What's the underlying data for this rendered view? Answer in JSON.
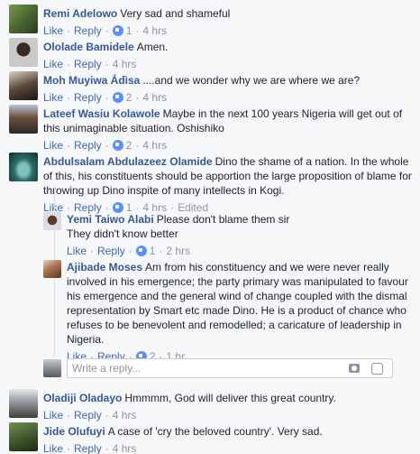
{
  "comments": [
    {
      "name": "Remi Adelowo",
      "text": "Very sad and shameful",
      "like": "Like",
      "reply": "Reply",
      "reactions": "1",
      "time": "4 hrs"
    },
    {
      "name": "Ololade Bamidele",
      "text": "Amen.",
      "like": "Like",
      "reply": "Reply",
      "time": "4 hrs"
    },
    {
      "name": "Moh Muyiwa Ádìsa",
      "text": "....and we wonder why we are where we are?",
      "like": "Like",
      "reply": "Reply",
      "reactions": "2",
      "time": "4 hrs"
    },
    {
      "name": "Lateef Wasiu Kolawole",
      "text": "Maybe in the next 100 years Nigeria will get out of this unimaginable situation. Oshishiko",
      "like": "Like",
      "reply": "Reply",
      "reactions": "2",
      "time": "4 hrs"
    },
    {
      "name": "Abdulsalam Abdulazeez Olamide",
      "text": "Dino the shame of a nation. In the whole of this, his constituents should be apportion the large proposition of blame for throwing up Dino inspite of many intellects in Kogi.",
      "like": "Like",
      "reply": "Reply",
      "reactions": "1",
      "time": "4 hrs",
      "edited": "Edited"
    }
  ],
  "replies": [
    {
      "name": "Yemi Taiwo Alabi",
      "text": "Please don't blame them sir",
      "text2": "They didn't know better",
      "like": "Like",
      "reply": "Reply",
      "reactions": "1",
      "time": "2 hrs"
    },
    {
      "name": "Ajibade Moses",
      "text": "Am from his constituency and we were never really involved in his emergence; the party primary was manipulated to favour his emergence and the general wind of change coupled with the dismal representation by Smart etc made Dino. He is a product of chance who refuses to be benevolent and remodelled; a caricature of leadership in Nigeria.",
      "like": "Like",
      "reply": "Reply",
      "reactions": "2",
      "time": "1 hr"
    }
  ],
  "reply_box": {
    "placeholder": "Write a reply..."
  },
  "more_comments": [
    {
      "name": "Oladiji Oladayo",
      "text": "Hmmmm, God will deliver this great country.",
      "like": "Like",
      "reply": "Reply",
      "time": "4 hrs"
    },
    {
      "name": "Jide Olufuyi",
      "text": "A case of 'cry the beloved country'. Very sad.",
      "like": "Like",
      "reply": "Reply",
      "time": "4 hrs"
    }
  ]
}
